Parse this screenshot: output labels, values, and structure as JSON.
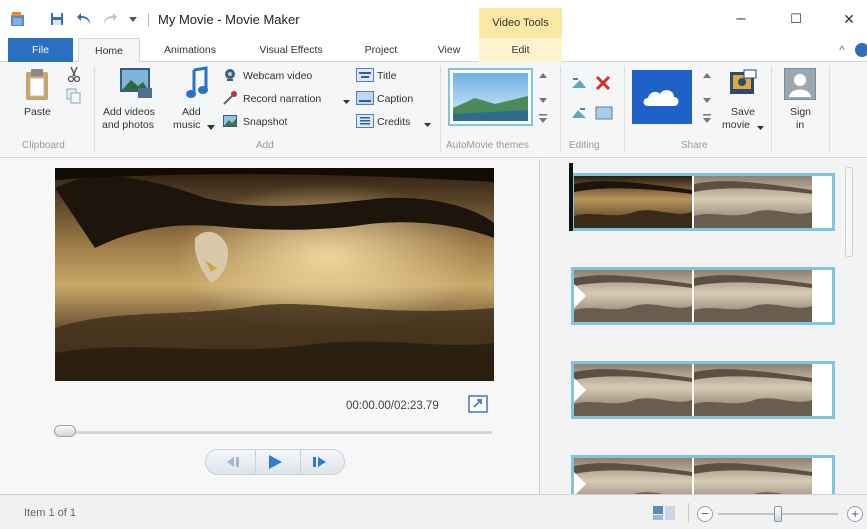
{
  "window": {
    "title": "My Movie - Movie Maker",
    "context_tab_group": "Video Tools",
    "minimize": "–",
    "maximize": "☐",
    "close": "✕"
  },
  "tabs": {
    "file": "File",
    "home": "Home",
    "animations": "Animations",
    "visual_effects": "Visual Effects",
    "project": "Project",
    "view": "View",
    "edit": "Edit",
    "collapse": "^",
    "help": "?"
  },
  "ribbon": {
    "clipboard": {
      "paste": "Paste",
      "group": "Clipboard"
    },
    "add": {
      "add_videos_line1": "Add videos",
      "add_videos_line2": "and photos",
      "add_music_line1": "Add",
      "add_music_line2": "music",
      "webcam": "Webcam video",
      "record": "Record narration",
      "snapshot": "Snapshot",
      "title": "Title",
      "caption": "Caption",
      "credits": "Credits",
      "group": "Add"
    },
    "themes": {
      "group": "AutoMovie themes"
    },
    "editing": {
      "group": "Editing"
    },
    "share": {
      "save_line1": "Save",
      "save_line2": "movie",
      "group": "Share"
    },
    "signin": {
      "line1": "Sign",
      "line2": "in"
    }
  },
  "preview": {
    "timecode": "00:00.00/02:23.79",
    "seek_position": 0.0
  },
  "storyboard": {
    "clips": 4
  },
  "status": {
    "item_text": "Item 1 of 1",
    "zoom_level": 0.5
  },
  "colors": {
    "file_tab": "#2b6fc1",
    "context_tab": "#fbe9a3",
    "clip_border": "#7ec4e4",
    "onedrive_tile": "#1e62c8"
  }
}
